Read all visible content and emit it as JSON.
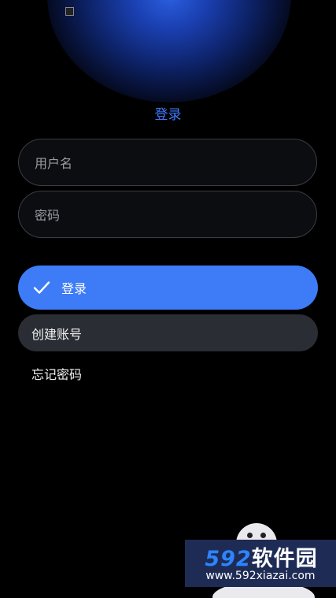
{
  "status_bar": {
    "icon": "notification-square-icon"
  },
  "header": {
    "title": "登录"
  },
  "form": {
    "username": {
      "value": "",
      "placeholder": "用户名"
    },
    "password": {
      "value": "",
      "placeholder": "密码"
    }
  },
  "actions": {
    "login_label": "登录",
    "login_icon": "check-icon",
    "create_account_label": "创建账号",
    "forgot_password_label": "忘记密码"
  },
  "watermark": {
    "digits": "592",
    "text": "软件园",
    "url": "www.592xiazai.com"
  },
  "colors": {
    "accent": "#3d7bf7",
    "title": "#3e7bff",
    "background": "#000000",
    "secondary_button": "#2a2d34"
  }
}
